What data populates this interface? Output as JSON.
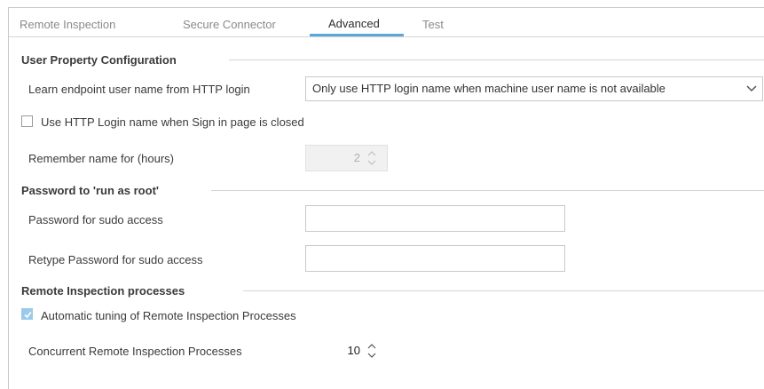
{
  "tabs": [
    {
      "label": "Remote Inspection",
      "active": false
    },
    {
      "label": "Secure Connector",
      "active": false
    },
    {
      "label": "Advanced",
      "active": true
    },
    {
      "label": "Test",
      "active": false
    }
  ],
  "user_property": {
    "title": "User Property Configuration",
    "learn_label": "Learn endpoint user name from HTTP login",
    "learn_value": "Only use HTTP login name when machine user name is not available",
    "use_http_label": "Use HTTP Login name when Sign in page is closed",
    "use_http_checked": false,
    "remember_label": "Remember name for (hours)",
    "remember_value": "2"
  },
  "password": {
    "title": "Password to 'run as root'",
    "sudo_label": "Password for sudo access",
    "sudo_value": "",
    "retype_label": "Retype Password for sudo access",
    "retype_value": ""
  },
  "remote_processes": {
    "title": "Remote Inspection processes",
    "auto_label": "Automatic tuning of Remote Inspection Processes",
    "auto_checked": true,
    "concurrent_label": "Concurrent Remote Inspection Processes",
    "concurrent_value": "10"
  },
  "colors": {
    "accent": "#5aa8db",
    "checkbox_checked": "#9cc9ea"
  }
}
